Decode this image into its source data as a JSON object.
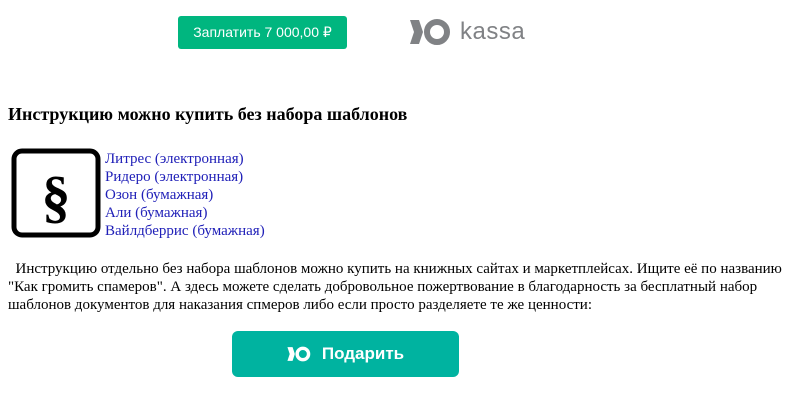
{
  "payment": {
    "pay_button_label": "Заплатить 7 000,00 ₽",
    "logo_text": "kassa"
  },
  "heading": "Инструкцию можно купить без набора шаблонов",
  "section_icon": "paragraph-section-icon",
  "shops": [
    "Литрес (электронная)",
    "Ридеро (электронная)",
    "Озон (бумажная)",
    "Али (бумажная)",
    "Вайлдберрис (бумажная)"
  ],
  "description": "Инструкцию отдельно без набора шаблонов можно купить на книжных сайтах и маркетплейсах. Ищите её по названию \"Как громить спамеров\". А здесь можете сделать добровольное пожертвование в благодарность за бесплатный набор шаблонов документов для наказания спмеров либо если просто разделяете те же ценности:",
  "donate": {
    "button_label": "Подарить"
  },
  "colors": {
    "pay_button": "#00b67f",
    "donate_button": "#00b3a0",
    "logo_gray": "#808285",
    "link": "#2020b8"
  }
}
